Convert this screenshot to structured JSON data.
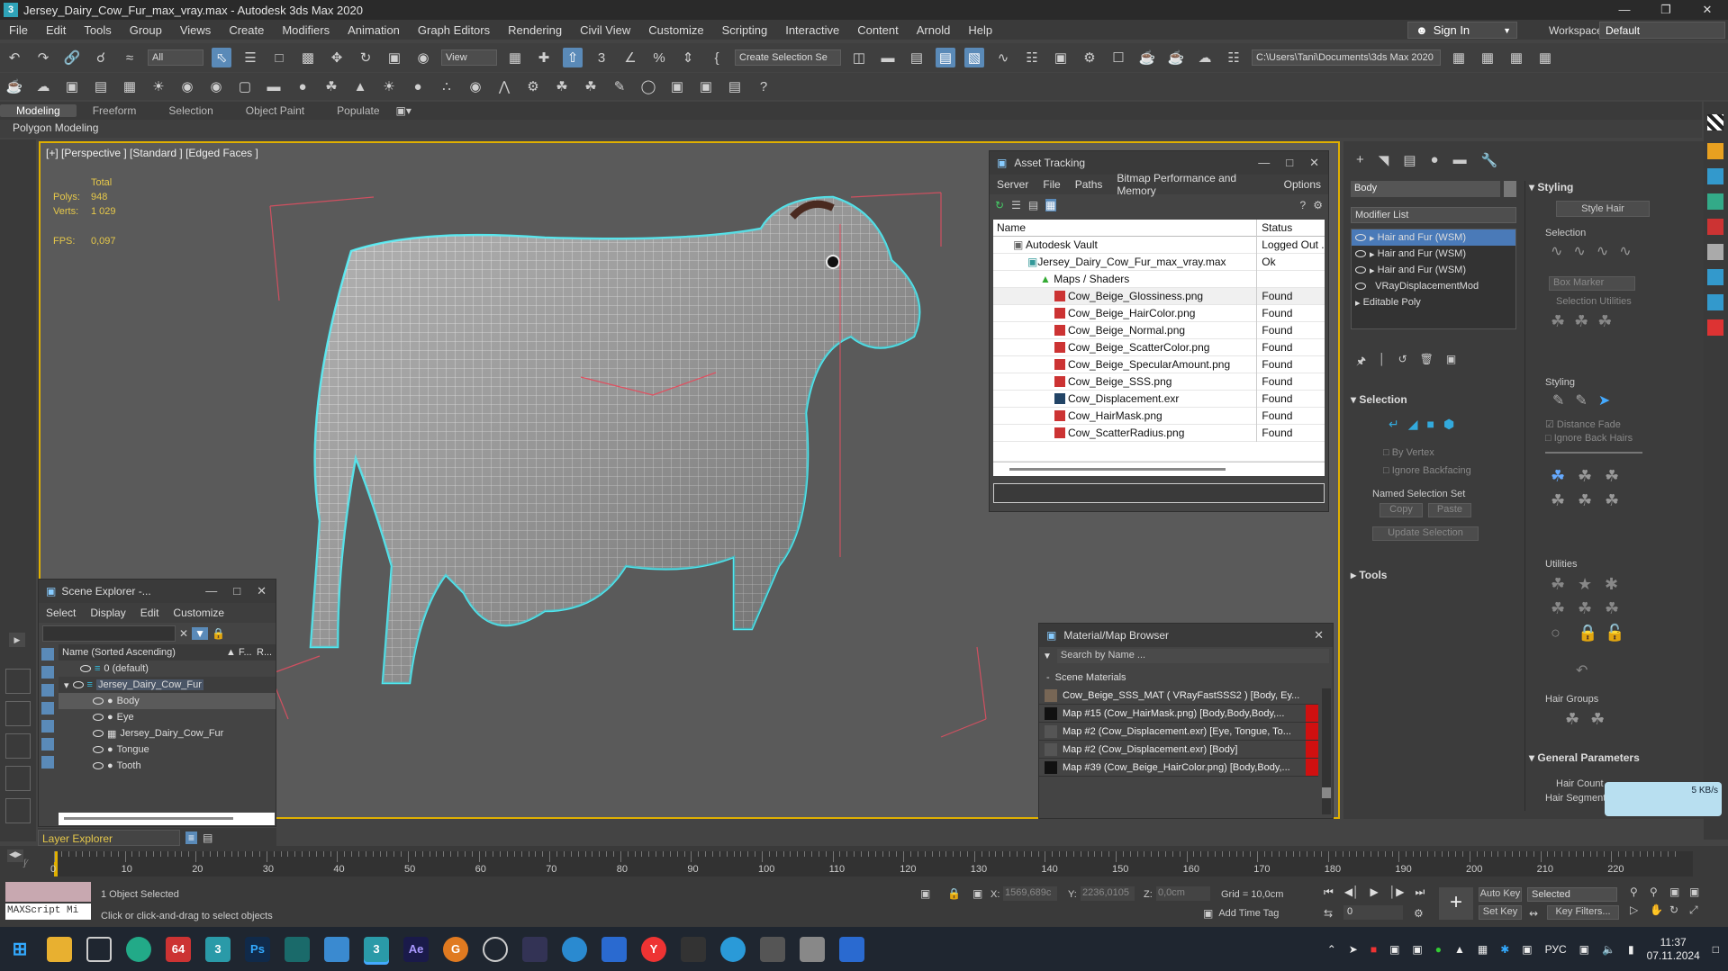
{
  "window": {
    "title": "Jersey_Dairy_Cow_Fur_max_vray.max - Autodesk 3ds Max 2020",
    "app_icon": "3"
  },
  "menu": [
    "File",
    "Edit",
    "Tools",
    "Group",
    "Views",
    "Create",
    "Modifiers",
    "Animation",
    "Graph Editors",
    "Rendering",
    "Civil View",
    "Customize",
    "Scripting",
    "Interactive",
    "Content",
    "Arnold",
    "Help"
  ],
  "account": {
    "sign_in": "Sign In",
    "workspaces_label": "Workspaces:",
    "workspace": "Default"
  },
  "toolbar": {
    "filter": "All",
    "view": "View",
    "selection_set": "Create Selection Se",
    "project_path": "C:\\Users\\Tani\\Documents\\3ds Max 2020"
  },
  "ribbon": {
    "tabs": [
      "Modeling",
      "Freeform",
      "Selection",
      "Object Paint",
      "Populate"
    ],
    "sub": "Polygon Modeling"
  },
  "viewport": {
    "label": "[+] [Perspective ] [Standard ] [Edged Faces ]",
    "stats": {
      "total": "Total",
      "polys_label": "Polys:",
      "polys": "948",
      "verts_label": "Verts:",
      "verts": "1 029",
      "fps_label": "FPS:",
      "fps": "0,097"
    }
  },
  "asset_tracking": {
    "title": "Asset Tracking",
    "menu": [
      "Server",
      "File",
      "Paths",
      "Bitmap Performance and Memory",
      "Options"
    ],
    "columns": [
      "Name",
      "Status"
    ],
    "rows": [
      {
        "name": "Autodesk Vault",
        "status": "Logged Out ..."
      },
      {
        "name": "Jersey_Dairy_Cow_Fur_max_vray.max",
        "status": "Ok"
      },
      {
        "name": "Maps / Shaders",
        "status": ""
      },
      {
        "name": "Cow_Beige_Glossiness.png",
        "status": "Found"
      },
      {
        "name": "Cow_Beige_HairColor.png",
        "status": "Found"
      },
      {
        "name": "Cow_Beige_Normal.png",
        "status": "Found"
      },
      {
        "name": "Cow_Beige_ScatterColor.png",
        "status": "Found"
      },
      {
        "name": "Cow_Beige_SpecularAmount.png",
        "status": "Found"
      },
      {
        "name": "Cow_Beige_SSS.png",
        "status": "Found"
      },
      {
        "name": "Cow_Displacement.exr",
        "status": "Found"
      },
      {
        "name": "Cow_HairMask.png",
        "status": "Found"
      },
      {
        "name": "Cow_ScatterRadius.png",
        "status": "Found"
      }
    ]
  },
  "scene_explorer": {
    "title": "Scene Explorer -...",
    "menu": [
      "Select",
      "Display",
      "Edit",
      "Customize"
    ],
    "header": {
      "name": "Name (Sorted Ascending)",
      "f": "▲ F...",
      "r": "R..."
    },
    "rows": [
      "0 (default)",
      "Jersey_Dairy_Cow_Fur",
      "Body",
      "Eye",
      "Jersey_Dairy_Cow_Fur",
      "Tongue",
      "Tooth"
    ],
    "layer_explorer": "Layer Explorer"
  },
  "material_browser": {
    "title": "Material/Map Browser",
    "search": "Search by Name ...",
    "group": "Scene Materials",
    "rows": [
      "Cow_Beige_SSS_MAT  ( VRayFastSSS2 )  [Body, Ey...",
      "Map #15 (Cow_HairMask.png) [Body,Body,Body,...",
      "Map #2 (Cow_Displacement.exr) [Eye, Tongue, To...",
      "Map #2 (Cow_Displacement.exr) [Body]",
      "Map #39 (Cow_Beige_HairColor.png) [Body,Body,..."
    ]
  },
  "command_panel": {
    "object_name": "Body",
    "modifier_list": "Modifier List",
    "stack": [
      "Hair and Fur (WSM)",
      "Hair and Fur (WSM)",
      "Hair and Fur (WSM)",
      "VRayDisplacementMod",
      "Editable Poly"
    ],
    "selection": {
      "title": "Selection",
      "by_vertex": "By Vertex",
      "ignore_backfacing": "Ignore Backfacing",
      "named_sel": "Named Selection Set",
      "copy": "Copy",
      "paste": "Paste",
      "update": "Update Selection"
    },
    "tools": "Tools",
    "styling": {
      "title": "Styling",
      "style_hair": "Style Hair",
      "selection": "Selection",
      "box_marker": "Box Marker",
      "sel_utilities": "Selection Utilities",
      "styling_sub": "Styling",
      "distance_fade": "Distance Fade",
      "ignore_back": "Ignore Back Hairs",
      "utilities": "Utilities",
      "hair_groups": "Hair Groups"
    },
    "general": {
      "title": "General Parameters",
      "hair_count": "Hair Count",
      "hair_segments": "Hair Segments"
    },
    "net_speed": "5 KB/s"
  },
  "timeline": {
    "ticks": [
      "0",
      "10",
      "20",
      "30",
      "40",
      "50",
      "60",
      "70",
      "80",
      "90",
      "100",
      "110",
      "120",
      "130",
      "140",
      "150",
      "160",
      "170",
      "180",
      "190",
      "200",
      "210",
      "220"
    ]
  },
  "status": {
    "selected": "1 Object Selected",
    "hint": "Click or click-and-drag to select objects",
    "maxscript": "MAXScript Mi",
    "x_label": "X:",
    "x": "1569,689c",
    "y_label": "Y:",
    "y": "2236,0105",
    "z_label": "Z:",
    "z": "0,0cm",
    "grid": "Grid = 10,0cm",
    "add_time_tag": "Add Time Tag",
    "auto_key": "Auto Key",
    "set_key": "Set Key",
    "selected_dd": "Selected",
    "key_filters": "Key Filters...",
    "frame": "0"
  },
  "taskbar": {
    "lang": "РУС",
    "time": "11:37",
    "date": "07.11.2024"
  }
}
